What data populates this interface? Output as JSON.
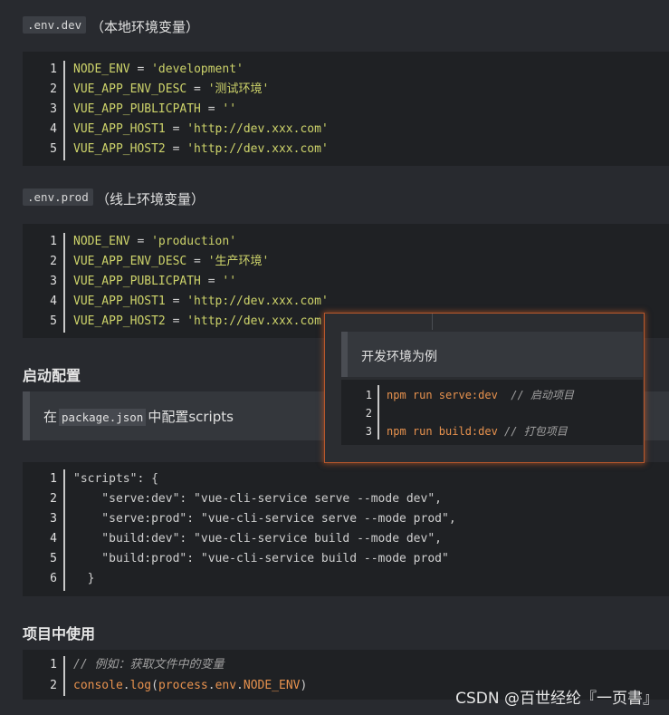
{
  "dev": {
    "filename": ".env.dev",
    "note": "（本地环境变量）",
    "lines": [
      {
        "n": "1",
        "key": "NODE_ENV",
        "eq": " = ",
        "val": "'development'"
      },
      {
        "n": "2",
        "key": "VUE_APP_ENV_DESC",
        "eq": " = ",
        "val": "'测试环境'"
      },
      {
        "n": "3",
        "key": "VUE_APP_PUBLICPATH",
        "eq": " = ",
        "val": "''"
      },
      {
        "n": "4",
        "key": "VUE_APP_HOST1",
        "eq": " = ",
        "val": "'http://dev.xxx.com'"
      },
      {
        "n": "5",
        "key": "VUE_APP_HOST2",
        "eq": " = ",
        "val": "'http://dev.xxx.com'"
      }
    ]
  },
  "prod": {
    "filename": ".env.prod",
    "note": "（线上环境变量）",
    "lines": [
      {
        "n": "1",
        "key": "NODE_ENV",
        "eq": " = ",
        "val": "'production'"
      },
      {
        "n": "2",
        "key": "VUE_APP_ENV_DESC",
        "eq": " = ",
        "val": "'生产环境'"
      },
      {
        "n": "3",
        "key": "VUE_APP_PUBLICPATH",
        "eq": " = ",
        "val": "''"
      },
      {
        "n": "4",
        "key": "VUE_APP_HOST1",
        "eq": " = ",
        "val": "'http://dev.xxx.com'"
      },
      {
        "n": "5",
        "key": "VUE_APP_HOST2",
        "eq": " = ",
        "val": "'http://dev.xxx.com'"
      }
    ]
  },
  "startup": {
    "heading": "启动配置",
    "quote_prefix": "在",
    "quote_code": "package.json",
    "quote_suffix": "中配置scripts",
    "lines": [
      {
        "n": "1",
        "text": "\"scripts\": {"
      },
      {
        "n": "2",
        "text": "    \"serve:dev\": \"vue-cli-service serve --mode dev\","
      },
      {
        "n": "3",
        "text": "    \"serve:prod\": \"vue-cli-service serve --mode prod\","
      },
      {
        "n": "4",
        "text": "    \"build:dev\": \"vue-cli-service build --mode dev\","
      },
      {
        "n": "5",
        "text": "    \"build:prod\": \"vue-cli-service build --mode prod\""
      },
      {
        "n": "6",
        "text": "  }"
      }
    ]
  },
  "overlay": {
    "quote": "开发环境为例",
    "lines": [
      {
        "n": "1",
        "cmd": "npm run serve:dev",
        "comment": "  // 启动项目"
      },
      {
        "n": "2",
        "cmd": "",
        "comment": ""
      },
      {
        "n": "3",
        "cmd": "npm run build:dev",
        "comment": " // 打包项目"
      }
    ]
  },
  "usage": {
    "heading": "项目中使用",
    "comment": "// 例如：获取文件中的变量",
    "code": {
      "n1": "1",
      "n2": "2",
      "console": "console",
      "dot1": ".",
      "log": "log",
      "open": "(",
      "process": "process",
      "dot2": ".",
      "env": "env",
      "dot3": ".",
      "node_env": "NODE_ENV",
      "close": ")"
    }
  },
  "watermark": "CSDN @百世经纶『一页書』"
}
